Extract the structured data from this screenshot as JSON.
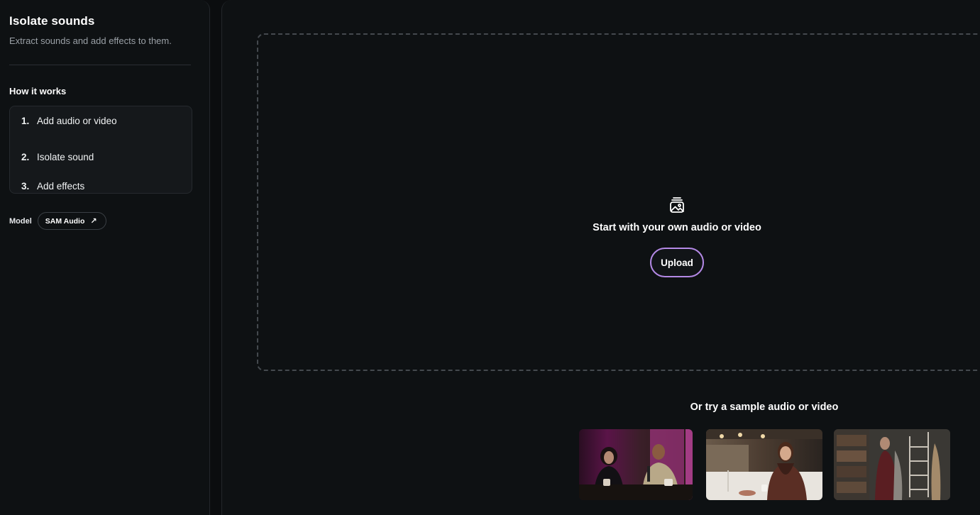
{
  "sidebar": {
    "title": "Isolate sounds",
    "subtitle": "Extract sounds and add effects to them.",
    "how_title": "How it works",
    "steps": [
      {
        "num": "1.",
        "label": "Add audio or video"
      },
      {
        "num": "2.",
        "label": "Isolate sound"
      },
      {
        "num": "3.",
        "label": "Add effects"
      }
    ],
    "model_label": "Model",
    "model_chip": "SAM Audio",
    "model_chip_icon": "↗"
  },
  "main": {
    "drop_icon": "image-stack-icon",
    "drop_text": "Start with your own audio or video",
    "upload_label": "Upload",
    "upload_border_color": "#b489e6",
    "sample_title": "Or try a sample audio or video",
    "samples": [
      {
        "name": "podcast-sample"
      },
      {
        "name": "cafe-sample"
      },
      {
        "name": "closet-sample"
      }
    ]
  }
}
